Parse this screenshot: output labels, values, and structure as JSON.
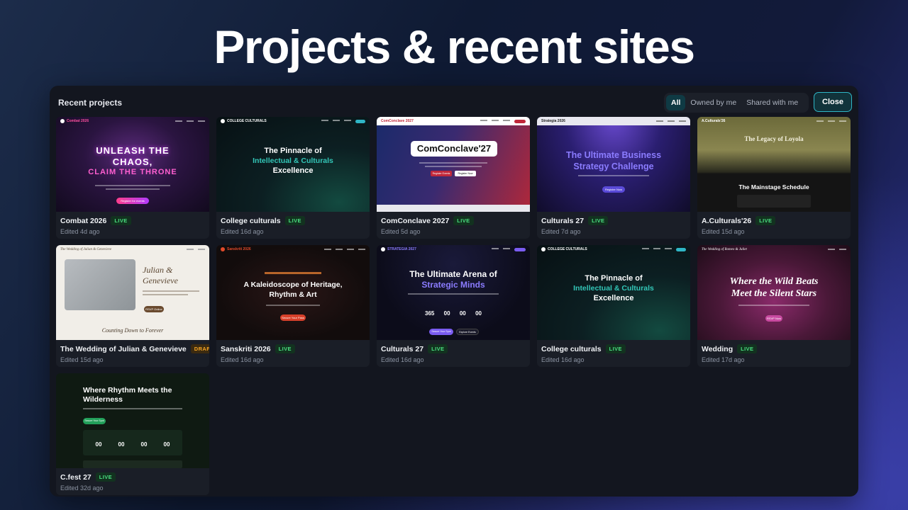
{
  "headline": "Projects & recent sites",
  "panel": {
    "title": "Recent projects",
    "filters": [
      "All",
      "Owned by me",
      "Shared with me"
    ],
    "close_label": "Close"
  },
  "projects": [
    {
      "name": "Combat 2026",
      "status": "LIVE",
      "edited": "Edited 4d ago",
      "thumb": {
        "logo": "Combat 2026",
        "line1": "UNLEASH THE",
        "line2": "CHAOS,",
        "line3": "CLAIM THE THRONE",
        "cta": "Register for events"
      }
    },
    {
      "name": "College culturals",
      "status": "LIVE",
      "edited": "Edited 16d ago",
      "thumb": {
        "logo": "COLLEGE CULTURALS",
        "line1": "The Pinnacle of",
        "line2": "Intellectual & Culturals",
        "line3": "Excellence"
      }
    },
    {
      "name": "ComConclave 2027",
      "status": "LIVE",
      "edited": "Edited 5d ago",
      "thumb": {
        "logo": "ComConclave 2027",
        "title": "ComConclave'27",
        "cta1": "Register Events",
        "cta2": "Register Now"
      }
    },
    {
      "name": "Culturals 27",
      "status": "LIVE",
      "edited": "Edited 7d ago",
      "thumb": {
        "logo": "Strategia 2026",
        "line1": "The Ultimate Business",
        "line2": "Strategy Challenge",
        "cta": "Register Now"
      }
    },
    {
      "name": "A.Culturals'26",
      "status": "LIVE",
      "edited": "Edited 15d ago",
      "thumb": {
        "logo": "A.Culturals'26",
        "line1": "The Legacy of Loyola",
        "line2": "The Mainstage Schedule"
      }
    },
    {
      "name": "The Wedding of Julian & Genevieve",
      "status": "DRAFT",
      "edited": "Edited 15d ago",
      "thumb": {
        "logo": "The Wedding of Julian & Genevieve",
        "line1": "Julian &",
        "line2": "Genevieve",
        "line3": "Counting Down to Forever",
        "cta": "RSVP Online"
      }
    },
    {
      "name": "Sanskriti 2026",
      "status": "LIVE",
      "edited": "Edited 16d ago",
      "thumb": {
        "logo": "Sanskriti 2026",
        "line1": "A Kaleidoscope of Heritage,",
        "line2": "Rhythm & Art",
        "cta": "Secure Your Pass"
      }
    },
    {
      "name": "Culturals 27",
      "status": "LIVE",
      "edited": "Edited 16d ago",
      "thumb": {
        "logo": "STRATEGIA 2027",
        "line1": "The Ultimate Arena of",
        "line2": "Strategic Minds",
        "count": [
          "365",
          "00",
          "00",
          "00"
        ],
        "cta1": "Secure Your Spot",
        "cta2": "Explore Events"
      }
    },
    {
      "name": "College culturals",
      "status": "LIVE",
      "edited": "Edited 16d ago",
      "thumb": {
        "logo": "COLLEGE CULTURALS",
        "line1": "The Pinnacle of",
        "line2": "Intellectual & Culturals",
        "line3": "Excellence"
      }
    },
    {
      "name": "Wedding",
      "status": "LIVE",
      "edited": "Edited 17d ago",
      "thumb": {
        "logo": "The Wedding of Romeo & Juliet",
        "line1": "Where the Wild Beats",
        "line2": "Meet the Silent Stars",
        "cta": "RSVP Now"
      }
    },
    {
      "name": "C.fest 27",
      "status": "LIVE",
      "edited": "Edited 32d ago",
      "thumb": {
        "line1": "Where Rhythm Meets the",
        "line2": "Wilderness",
        "count": [
          "00",
          "00",
          "00",
          "00"
        ],
        "cta": "Secure Your Spot"
      }
    }
  ],
  "colors": {
    "accent": "#2fb6c6",
    "live_badge": "#4ade80",
    "draft_badge": "#f5a524",
    "panel_bg": "#13161f",
    "card_bg": "#1a1e27"
  }
}
